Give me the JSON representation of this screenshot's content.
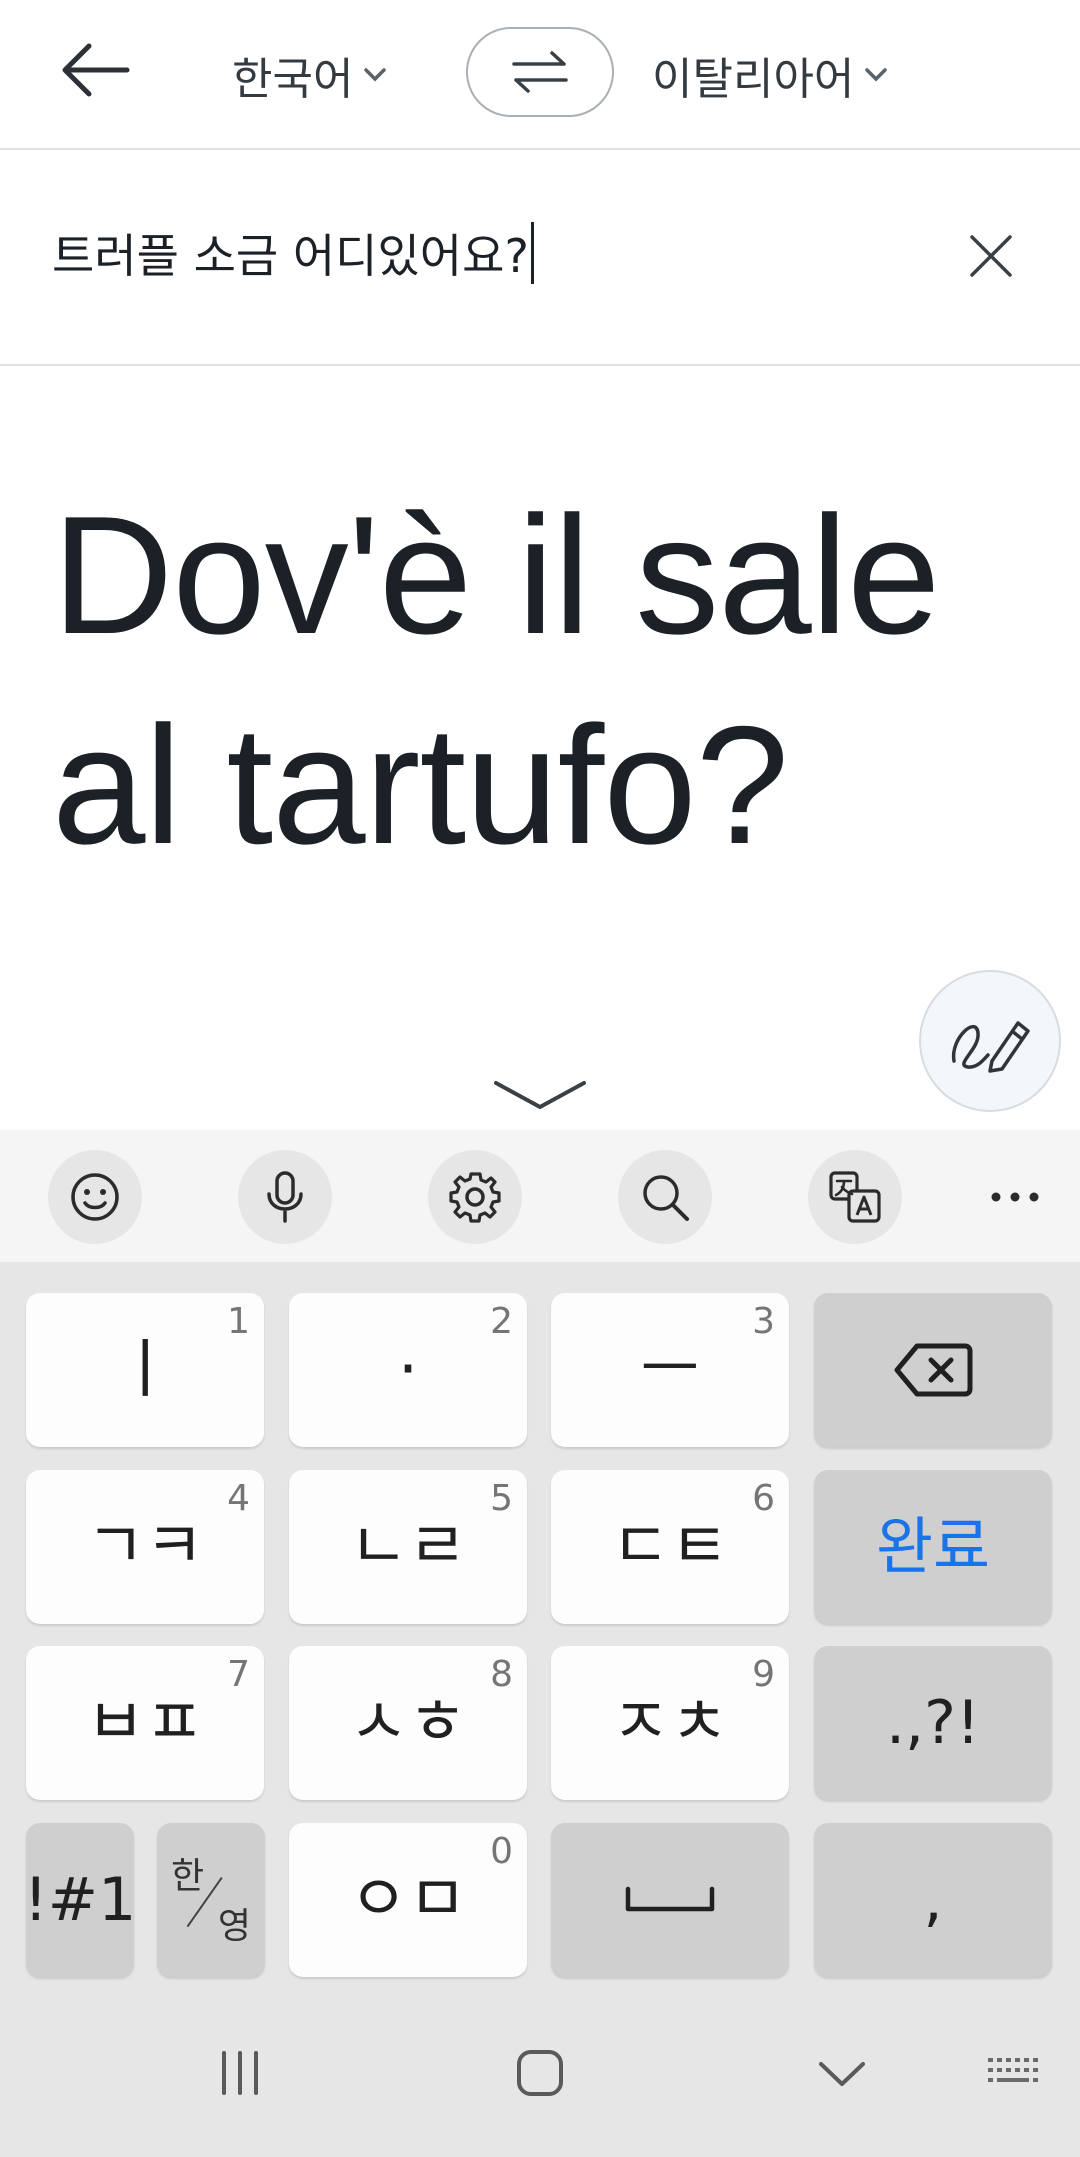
{
  "header": {
    "source_lang": "한국어",
    "target_lang": "이탈리아어"
  },
  "input": {
    "text": "트러플 소금 어디있어요?"
  },
  "output": {
    "line1": "Dov'è il sale",
    "line2": "al tartufo?"
  },
  "keyboard": {
    "rows": [
      [
        {
          "label": "ㅣ",
          "num": "1"
        },
        {
          "label": "·",
          "num": "2"
        },
        {
          "label": "ㅡ",
          "num": "3"
        }
      ],
      [
        {
          "label": "ㄱㅋ",
          "num": "4"
        },
        {
          "label": "ㄴㄹ",
          "num": "5"
        },
        {
          "label": "ㄷㅌ",
          "num": "6"
        }
      ],
      [
        {
          "label": "ㅂㅍ",
          "num": "7"
        },
        {
          "label": "ㅅㅎ",
          "num": "8"
        },
        {
          "label": "ㅈㅊ",
          "num": "9"
        }
      ],
      [
        {
          "label": "ㅇㅁ",
          "num": "0"
        }
      ]
    ],
    "done_label": "완료",
    "punct_label": ".,?!",
    "symbols_label": "!#1",
    "han_label": "한",
    "yeong_label": "영",
    "comma_label": ","
  },
  "colors": {
    "accent": "#1a73e8",
    "keyboard_bg": "#e6e6e6",
    "key_bg": "#fdfdfd",
    "func_key_bg": "#cfcfcf"
  }
}
